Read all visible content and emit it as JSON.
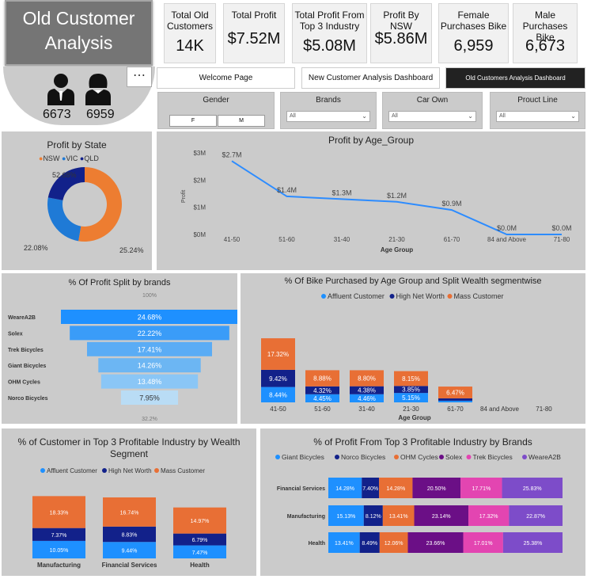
{
  "header": {
    "title": "Old Customer Analysis",
    "more_icon": "more-options-icon",
    "male_count": "6673",
    "female_count": "6959"
  },
  "kpis": [
    {
      "label": "Total Old Customers",
      "value": "14K"
    },
    {
      "label": "Total Profit",
      "value": "$7.52M"
    },
    {
      "label": "Total Profit From Top 3 Industry",
      "value": "$5.08M"
    },
    {
      "label": "Profit By NSW",
      "value": "$5.86M"
    },
    {
      "label": "Female Purchases Bike",
      "value": "6,959"
    },
    {
      "label": "Male Purchases Bike",
      "value": "6,673"
    }
  ],
  "nav": {
    "welcome": "Welcome Page",
    "new_customer": "New Customer Analysis Dashboard",
    "old_customer": "Old Customers Analysis Dashboard"
  },
  "slicers": {
    "gender": {
      "title": "Gender",
      "options": [
        "F",
        "M"
      ]
    },
    "brands": {
      "title": "Brands",
      "value": "All"
    },
    "car_own": {
      "title": "Car Own",
      "value": "All"
    },
    "product_line": {
      "title": "Prouct Line",
      "value": "All"
    }
  },
  "colors": {
    "nsw": "#ed7d31",
    "vic": "#1f7ad6",
    "qld": "#12218a",
    "affluent": "#1e90ff",
    "high_net_worth": "#12218a",
    "mass": "#e86f35",
    "panel": "#cbcbcb"
  },
  "chart_data": [
    {
      "type": "pie",
      "title": "Profit by State",
      "categories": [
        "NSW",
        "VIC",
        "QLD"
      ],
      "values": [
        52.68,
        25.24,
        22.08
      ],
      "labels": [
        "52.68%",
        "25.24%",
        "22.08%"
      ]
    },
    {
      "type": "line",
      "title": "Profit by Age_Group",
      "xlabel": "Age Group",
      "ylabel": "Profit",
      "categories": [
        "41-50",
        "51-60",
        "31-40",
        "21-30",
        "61-70",
        "84 and Above",
        "71-80"
      ],
      "values": [
        2.7,
        1.4,
        1.3,
        1.2,
        0.9,
        0.0,
        0.0
      ],
      "labels": [
        "$2.7M",
        "$1.4M",
        "$1.3M",
        "$1.2M",
        "$0.9M",
        "$0.0M",
        "$0.0M"
      ],
      "yticks": [
        "$0M",
        "$1M",
        "$2M",
        "$3M"
      ],
      "ylim": [
        0,
        3
      ]
    },
    {
      "type": "bar",
      "title": "% Of Profit Split by brands",
      "categories": [
        "WeareA2B",
        "Solex",
        "Trek Bicycles",
        "Giant Bicycles",
        "OHM Cycles",
        "Norco Bicycles"
      ],
      "values": [
        24.68,
        22.22,
        17.41,
        14.26,
        13.48,
        7.95
      ],
      "labels": [
        "24.68%",
        "22.22%",
        "17.41%",
        "14.26%",
        "13.48%",
        "7.95%"
      ],
      "top_label": "100%",
      "bottom_label": "32.2%"
    },
    {
      "type": "bar",
      "title": "% Of Bike Purchased by Age Group and Split Wealth segmentwise",
      "xlabel": "Age Group",
      "categories": [
        "41-50",
        "51-60",
        "31-40",
        "21-30",
        "61-70",
        "84 and Above",
        "71-80"
      ],
      "series": [
        {
          "name": "Affluent Customer",
          "values": [
            8.44,
            4.45,
            4.46,
            5.15,
            0.9,
            0,
            0
          ],
          "labels": [
            "8.44%",
            "4.45%",
            "4.46%",
            "5.15%",
            "",
            "",
            ""
          ]
        },
        {
          "name": "High Net Worth",
          "values": [
            9.42,
            4.32,
            4.38,
            3.85,
            1.3,
            0,
            0
          ],
          "labels": [
            "9.42%",
            "4.32%",
            "4.38%",
            "3.85%",
            "",
            "",
            ""
          ]
        },
        {
          "name": "Mass Customer",
          "values": [
            17.32,
            8.88,
            8.8,
            8.15,
            6.47,
            0,
            0
          ],
          "labels": [
            "17.32%",
            "8.88%",
            "8.80%",
            "8.15%",
            "6.47%",
            "",
            ""
          ]
        }
      ]
    },
    {
      "type": "bar",
      "title": "% of Customer in Top 3 Profitable Industry by Wealth Segment",
      "categories": [
        "Manufacturing",
        "Financial Services",
        "Health"
      ],
      "series": [
        {
          "name": "Affluent Customer",
          "values": [
            10.05,
            9.44,
            7.47
          ],
          "labels": [
            "10.05%",
            "9.44%",
            "7.47%"
          ]
        },
        {
          "name": "High Net Worth",
          "values": [
            7.37,
            8.83,
            6.79
          ],
          "labels": [
            "7.37%",
            "8.83%",
            "6.79%"
          ]
        },
        {
          "name": "Mass Customer",
          "values": [
            18.33,
            16.74,
            14.97
          ],
          "labels": [
            "18.33%",
            "16.74%",
            "14.97%"
          ]
        }
      ]
    },
    {
      "type": "bar",
      "title": "% of Profit From Top 3 Profitable Industry by Brands",
      "categories": [
        "Financial Services",
        "Manufacturing",
        "Health"
      ],
      "series": [
        {
          "name": "Giant Bicycles",
          "color": "#1e90ff",
          "values": [
            14.28,
            15.13,
            13.41
          ],
          "labels": [
            "14.28%",
            "15.13%",
            "13.41%"
          ]
        },
        {
          "name": "Norco Bicycles",
          "color": "#12218a",
          "values": [
            7.4,
            8.12,
            8.49
          ],
          "labels": [
            "7.40%",
            "8.12%",
            "8.49%"
          ]
        },
        {
          "name": "OHM Cycles",
          "color": "#e86f35",
          "values": [
            14.28,
            13.41,
            12.06
          ],
          "labels": [
            "14.28%",
            "13.41%",
            "12.06%"
          ]
        },
        {
          "name": "Solex",
          "color": "#6b0f86",
          "values": [
            20.5,
            23.14,
            23.66
          ],
          "labels": [
            "20.50%",
            "23.14%",
            "23.66%"
          ]
        },
        {
          "name": "Trek Bicycles",
          "color": "#e345b1",
          "values": [
            17.71,
            17.32,
            17.01
          ],
          "labels": [
            "17.71%",
            "17.32%",
            "17.01%"
          ]
        },
        {
          "name": "WeareA2B",
          "color": "#7d4cc9",
          "values": [
            25.83,
            22.87,
            25.38
          ],
          "labels": [
            "25.83%",
            "22.87%",
            "25.38%"
          ]
        }
      ]
    }
  ]
}
